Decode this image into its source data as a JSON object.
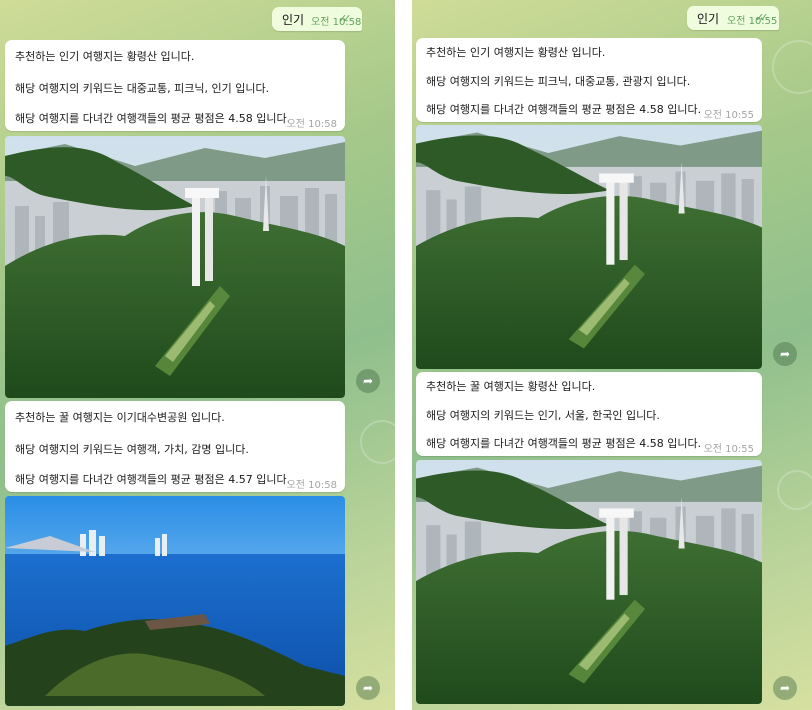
{
  "left_chat": {
    "sent_message": {
      "text": "인기",
      "time": "오전 10:58",
      "status_icon": "double-check-icon"
    },
    "messages": [
      {
        "lines": [
          "추천하는 인기 여행지는 황령산 입니다.",
          "해당 여행지의 키워드는 대중교통, 피크닉, 인기 입니다.",
          "해당 여행지를 다녀간 여행객들의 평균 평점은 4.58 입니다."
        ],
        "time": "오전 10:58"
      },
      {
        "lines": [
          "추천하는 꿀 여행지는 이기대수변공원 입니다.",
          "해당 여행지의 키워드는 여행객, 가치, 감명 입니다.",
          "해당 여행지를 다녀간 여행객들의 평균 평점은 4.57 입니다."
        ],
        "time": "오전 10:58"
      }
    ],
    "photos": [
      "mountain-tower-photo",
      "seaside-park-photo"
    ]
  },
  "right_chat": {
    "sent_message": {
      "text": "인기",
      "time": "오전 10:55",
      "status_icon": "double-check-icon"
    },
    "messages": [
      {
        "lines": [
          "추천하는 인기 여행지는 황령산 입니다.",
          "해당 여행지의 키워드는 피크닉, 대중교통, 관광지 입니다.",
          "해당 여행지를 다녀간 여행객들의 평균 평점은 4.58 입니다."
        ],
        "time": "오전 10:55"
      },
      {
        "lines": [
          "추천하는 꿀 여행지는 황령산 입니다.",
          "해당 여행지의 키워드는 인기, 서울, 한국인 입니다.",
          "해당 여행지를 다녀간 여행객들의 평균 평점은 4.58 입니다."
        ],
        "time": "오전 10:55"
      }
    ],
    "photos": [
      "mountain-tower-photo",
      "mountain-tower-photo"
    ]
  },
  "icons": {
    "forward": "forward-arrow-icon",
    "read_receipt": "double-check-icon"
  },
  "colors": {
    "outgoing_bubble": "#effdde",
    "incoming_bubble": "#ffffff",
    "time_green": "#5fa25a",
    "wallpaper": "#a6c98a"
  }
}
